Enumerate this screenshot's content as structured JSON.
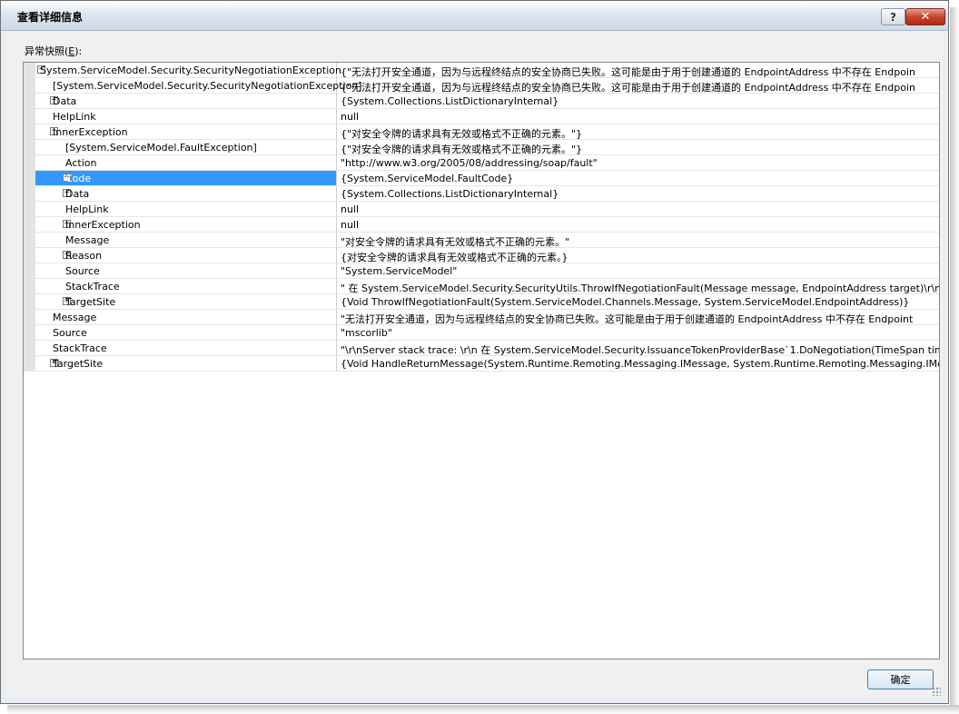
{
  "window": {
    "title": "查看详细信息",
    "help_label": "?",
    "close_label": "✕"
  },
  "snapshot_label": "异常快照(",
  "snapshot_label_key": "E",
  "snapshot_label_end": "):",
  "ok_label": "确定",
  "rows": [
    {
      "name": "System.ServiceModel.Security.SecurityNegotiationException",
      "value": "{\"无法打开安全通道，因为与远程终结点的安全协商已失败。这可能是由于用于创建通道的 EndpointAddress 中不存在 Endpoin",
      "indent": 0,
      "expander": "minus"
    },
    {
      "name": "[System.ServiceModel.Security.SecurityNegotiationException]",
      "value": "{\"无法打开安全通道，因为与远程终结点的安全协商已失败。这可能是由于用于创建通道的 EndpointAddress 中不存在 Endpoin",
      "indent": 1,
      "expander": ""
    },
    {
      "name": "Data",
      "value": "{System.Collections.ListDictionaryInternal}",
      "indent": 1,
      "expander": "plus"
    },
    {
      "name": "HelpLink",
      "value": "null",
      "indent": 1,
      "expander": ""
    },
    {
      "name": "InnerException",
      "value": "{\"对安全令牌的请求具有无效或格式不正确的元素。\"}",
      "indent": 1,
      "expander": "minus"
    },
    {
      "name": "[System.ServiceModel.FaultException]",
      "value": "{\"对安全令牌的请求具有无效或格式不正确的元素。\"}",
      "indent": 2,
      "expander": ""
    },
    {
      "name": "Action",
      "value": "\"http://www.w3.org/2005/08/addressing/soap/fault\"",
      "indent": 2,
      "expander": ""
    },
    {
      "name": "Code",
      "value": "{System.ServiceModel.FaultCode}",
      "indent": 2,
      "expander": "plus",
      "selected": true
    },
    {
      "name": "Data",
      "value": "{System.Collections.ListDictionaryInternal}",
      "indent": 2,
      "expander": "plus"
    },
    {
      "name": "HelpLink",
      "value": "null",
      "indent": 2,
      "expander": ""
    },
    {
      "name": "InnerException",
      "value": "null",
      "indent": 2,
      "expander": "plus"
    },
    {
      "name": "Message",
      "value": "\"对安全令牌的请求具有无效或格式不正确的元素。\"",
      "indent": 2,
      "expander": ""
    },
    {
      "name": "Reason",
      "value": "{对安全令牌的请求具有无效或格式不正确的元素。}",
      "indent": 2,
      "expander": "plus"
    },
    {
      "name": "Source",
      "value": "\"System.ServiceModel\"",
      "indent": 2,
      "expander": ""
    },
    {
      "name": "StackTrace",
      "value": "\"   在 System.ServiceModel.Security.SecurityUtils.ThrowIfNegotiationFault(Message message, EndpointAddress target)\\r\\n   在 System.",
      "indent": 2,
      "expander": ""
    },
    {
      "name": "TargetSite",
      "value": "{Void ThrowIfNegotiationFault(System.ServiceModel.Channels.Message, System.ServiceModel.EndpointAddress)}",
      "indent": 2,
      "expander": "plus"
    },
    {
      "name": "Message",
      "value": "\"无法打开安全通道，因为与远程终结点的安全协商已失败。这可能是由于用于创建通道的 EndpointAddress 中不存在 Endpoint",
      "indent": 1,
      "expander": ""
    },
    {
      "name": "Source",
      "value": "\"mscorlib\"",
      "indent": 1,
      "expander": ""
    },
    {
      "name": "StackTrace",
      "value": "\"\\r\\nServer stack trace: \\r\\n   在 System.ServiceModel.Security.IssuanceTokenProviderBase`1.DoNegotiation(TimeSpan timeout)\\r\\n   在",
      "indent": 1,
      "expander": ""
    },
    {
      "name": "TargetSite",
      "value": "{Void HandleReturnMessage(System.Runtime.Remoting.Messaging.IMessage, System.Runtime.Remoting.Messaging.IMessage)}",
      "indent": 1,
      "expander": "plus"
    }
  ]
}
